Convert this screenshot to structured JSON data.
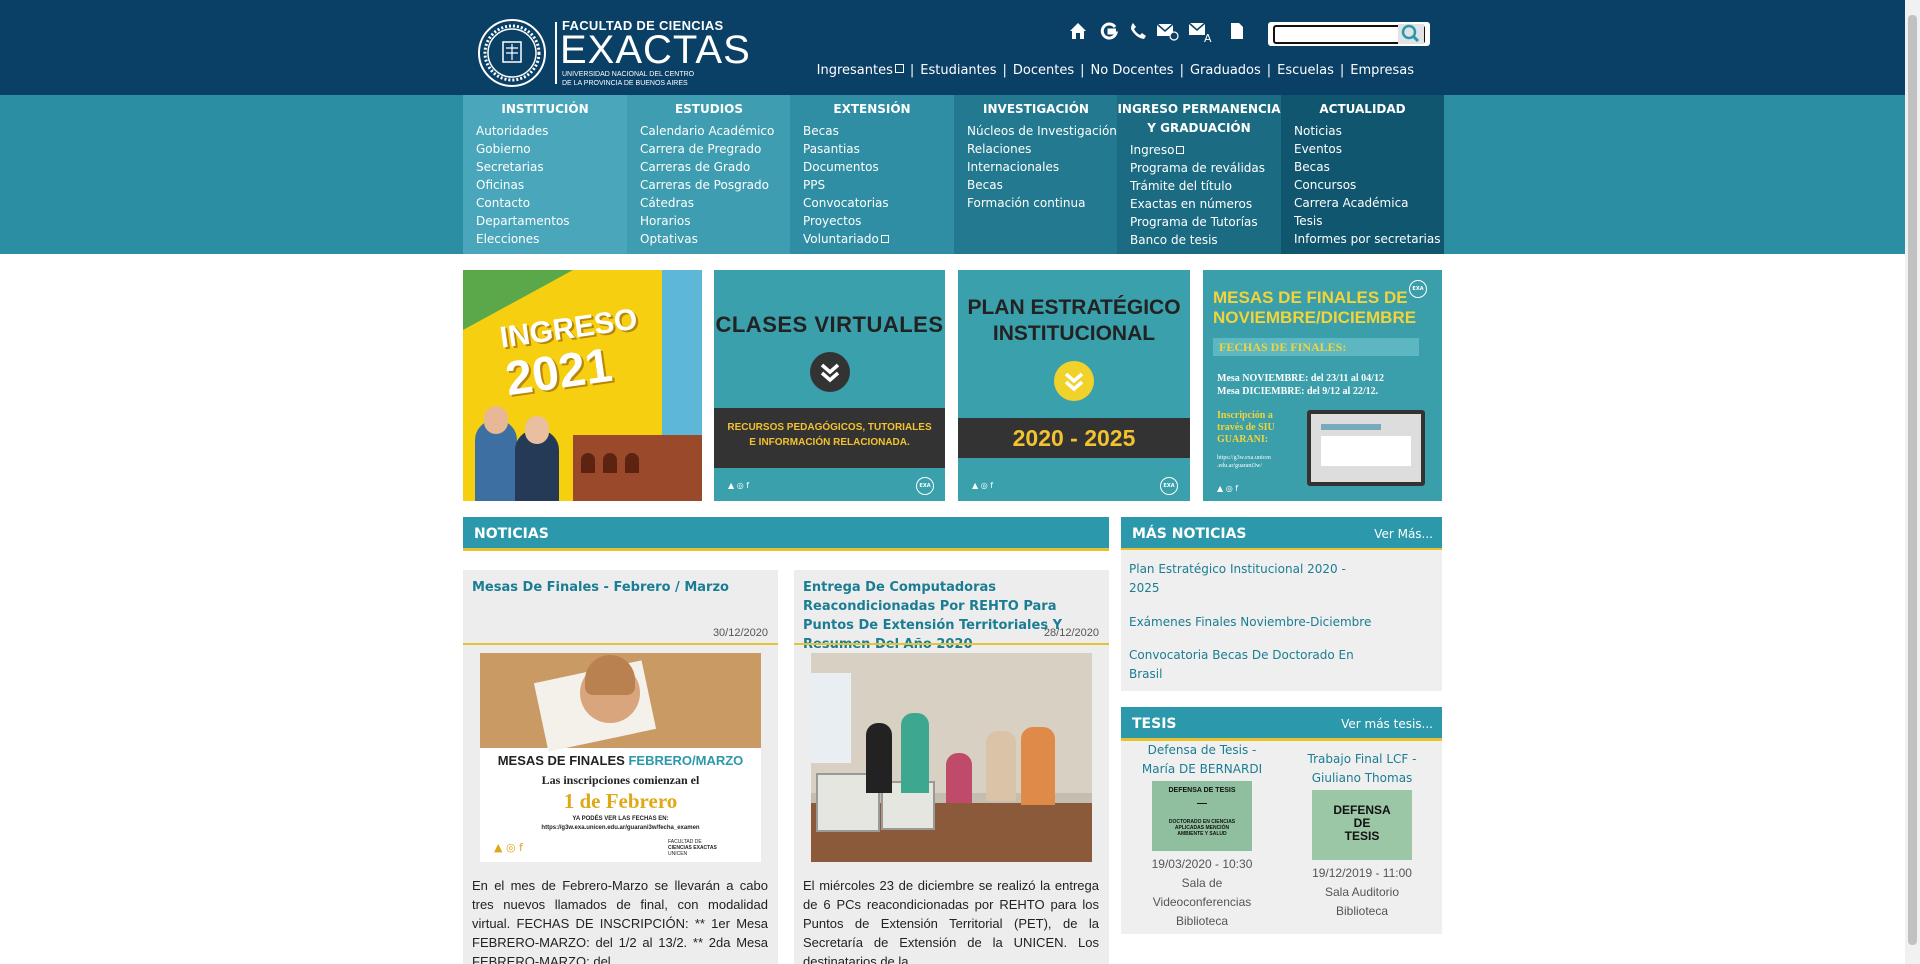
{
  "header": {
    "logo": {
      "line1": "FACULTAD DE CIENCIAS",
      "line2": "EXACTAS",
      "line3a": "UNIVERSIDAD NACIONAL DEL CENTRO",
      "line3b": "DE LA PROVINCIA DE BUENOS AIRES"
    },
    "icons": [
      "home-icon",
      "g-icon",
      "phone-icon",
      "mail-d-icon",
      "mail-a-icon",
      "document-icon"
    ],
    "search": {
      "value": "",
      "placeholder": ""
    },
    "user_nav": [
      "Ingresantes",
      "Estudiantes",
      "Docentes",
      "No Docentes",
      "Graduados",
      "Escuelas",
      "Empresas"
    ]
  },
  "menu": [
    {
      "title": "INSTITUCIÓN",
      "items": [
        "Autoridades",
        "Gobierno",
        "Secretarias",
        "Oficinas",
        "Contacto",
        "Departamentos",
        "Elecciones"
      ]
    },
    {
      "title": "ESTUDIOS",
      "items": [
        "Calendario Académico",
        "Carrera de Pregrado",
        "Carreras de Grado",
        "Carreras de Posgrado",
        "Cátedras",
        "Horarios",
        "Optativas"
      ]
    },
    {
      "title": "EXTENSIÓN",
      "items": [
        "Becas",
        "Pasantias",
        "Documentos",
        "PPS",
        "Convocatorias",
        "Proyectos",
        "Voluntariado"
      ]
    },
    {
      "title": "INVESTIGACIÓN",
      "items": [
        "Núcleos de Investigación",
        "Relaciones",
        "Internacionales",
        "Becas",
        "Formación continua"
      ]
    },
    {
      "title_line1": "INGRESO PERMANENCIA",
      "title_line2": "Y GRADUACIÓN",
      "items": [
        "Ingreso",
        "Programa de reválidas",
        "Trámite del título",
        "Exactas en números",
        "Programa de Tutorías",
        "Banco de tesis"
      ]
    },
    {
      "title": "ACTUALIDAD",
      "items": [
        "Noticias",
        "Eventos",
        "Becas",
        "Concursos",
        "Carrera Académica",
        "Tesis",
        "Informes por secretarias"
      ]
    }
  ],
  "banners": {
    "b1": {
      "line1": "INGRESO",
      "line2": "2021"
    },
    "b2": {
      "title": "CLASES VIRTUALES",
      "sub1": "RECURSOS PEDAGÓGICOS, TUTORIALES",
      "sub2": "E INFORMACIÓN RELACIONADA."
    },
    "b3": {
      "title1": "PLAN ESTRATÉGICO",
      "title2": "INSTITUCIONAL",
      "years": "2020 - 2025"
    },
    "b4": {
      "title1": "MESAS DE FINALES DE",
      "title2": "NOVIEMBRE/DICIEMBRE",
      "fechas": "FECHAS DE FINALES:",
      "nov": "Mesa NOVIEMBRE: del 23/11 al 04/12",
      "dic": "Mesa DICIEMBRE: del 9/12 al 22/12.",
      "insc1": "Inscripción a",
      "insc2": "través de SIU",
      "insc3": "GUARANI:",
      "url1": "https://g3w.exa.unicen",
      "url2": ".edu.ar/guarani3w/"
    },
    "exa_badge": "EXA"
  },
  "noticias": {
    "heading": "NOTICIAS",
    "items": [
      {
        "title": "Mesas De Finales - Febrero / Marzo",
        "date": "30/12/2020",
        "img": {
          "line1": "MESAS DE FINALES ",
          "line1b": "FEBRERO/MARZO",
          "line2": "Las inscripciones comienzan el",
          "line3": "1 de Febrero",
          "line4": "YA PODÉS VER LAS FECHAS EN:",
          "line5": "https://g3w.exa.unicen.edu.ar/guarani3w/fecha_examen",
          "brand1": "FACULTAD DE",
          "brand2": "CIENCIAS EXACTAS",
          "brand3": "UNICEN"
        },
        "body": "En el mes de Febrero-Marzo se llevarán a cabo tres nuevos llamados de final, con modalidad virtual.  FECHAS DE INSCRIPCIÓN: ** 1er Mesa FEBRERO-MARZO: del 1/2 al 13/2. ** 2da Mesa FEBRERO-MARZO: del"
      },
      {
        "title": "Entrega De Computadoras Reacondicionadas Por REHTO Para Puntos De Extensión Territoriales Y Resumen Del Año 2020",
        "date": "28/12/2020",
        "body": "El miércoles 23 de diciembre se realizó  la entrega de 6 PCs reacondicionadas por REHTO para los Puntos de Extensión Territorial (PET), de la Secretaría de Extensión de la UNICEN. Los destinatarios de la"
      }
    ]
  },
  "mas_noticias": {
    "heading": "MÁS NOTICIAS",
    "more": "Ver Más...",
    "items": [
      "Plan Estratégico Institucional 2020 - 2025",
      "Exámenes Finales Noviembre-Diciembre",
      "Convocatoria Becas De Doctorado En Brasil"
    ]
  },
  "tesis": {
    "heading": "TESIS",
    "more": "Ver más tesis...",
    "items": [
      {
        "title": "Defensa de Tesis - María DE BERNARDI",
        "thumb1": "DEFENSA DE TESIS",
        "thumb2": "DOCTORADO EN CIENCIAS APLICADAS MENCIÓN AMBIENTE Y SALUD",
        "datetime": "19/03/2020 - 10:30",
        "place": "Sala de Videoconferencias Biblioteca"
      },
      {
        "title": "Trabajo Final LCF - Giuliano Thomas",
        "thumb1": "DEFENSA",
        "thumb1b": "DE",
        "thumb1c": "TESIS",
        "datetime": "19/12/2019 - 11:00",
        "place": "Sala Auditorio Biblioteca"
      }
    ]
  },
  "colors": {
    "header": "#0a3f66",
    "menu": "#2c8ea3",
    "accent": "#e9c22b",
    "link": "#1a7d93"
  }
}
